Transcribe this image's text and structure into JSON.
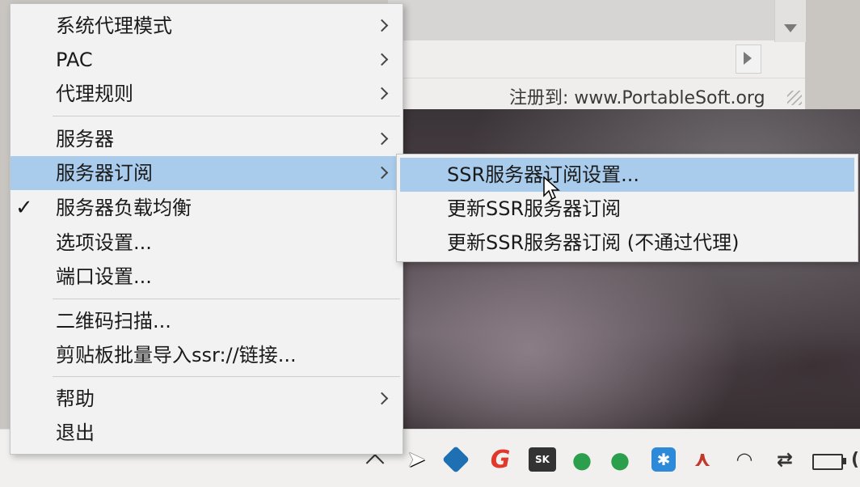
{
  "background_window": {
    "registered_text": "注册到: www.PortableSoft.org"
  },
  "menu": {
    "items": [
      {
        "label": "系统代理模式",
        "submenu": true
      },
      {
        "label": "PAC",
        "submenu": true
      },
      {
        "label": "代理规则",
        "submenu": true
      },
      {
        "label": "服务器",
        "submenu": true
      },
      {
        "label": "服务器订阅",
        "submenu": true,
        "highlighted": true
      },
      {
        "label": "服务器负载均衡",
        "checked": true
      },
      {
        "label": "选项设置..."
      },
      {
        "label": "端口设置..."
      },
      {
        "label": "二维码扫描..."
      },
      {
        "label": "剪贴板批量导入ssr://链接..."
      },
      {
        "label": "帮助",
        "submenu": true
      },
      {
        "label": "退出"
      }
    ],
    "check_mark": "✓"
  },
  "submenu": {
    "items": [
      {
        "label": "SSR服务器订阅设置...",
        "highlighted": true
      },
      {
        "label": "更新SSR服务器订阅"
      },
      {
        "label": "更新SSR服务器订阅 (不通过代理)"
      }
    ]
  },
  "taskbar": {
    "icons": [
      "chevron-up-icon",
      "cursor-icon",
      "shield-app-icon",
      "g-app-icon",
      "sk-app-icon",
      "teamviewer-icon",
      "teamviewer-icon",
      "bluetooth-icon",
      "upload-app-icon",
      "wifi-icon",
      "network-arrows-icon",
      "battery-icon"
    ],
    "sk_label": "SK"
  },
  "colors": {
    "menu_bg": "#f2f2f2",
    "highlight": "#a9ccec",
    "taskbar_bg": "#f1f0ef"
  }
}
